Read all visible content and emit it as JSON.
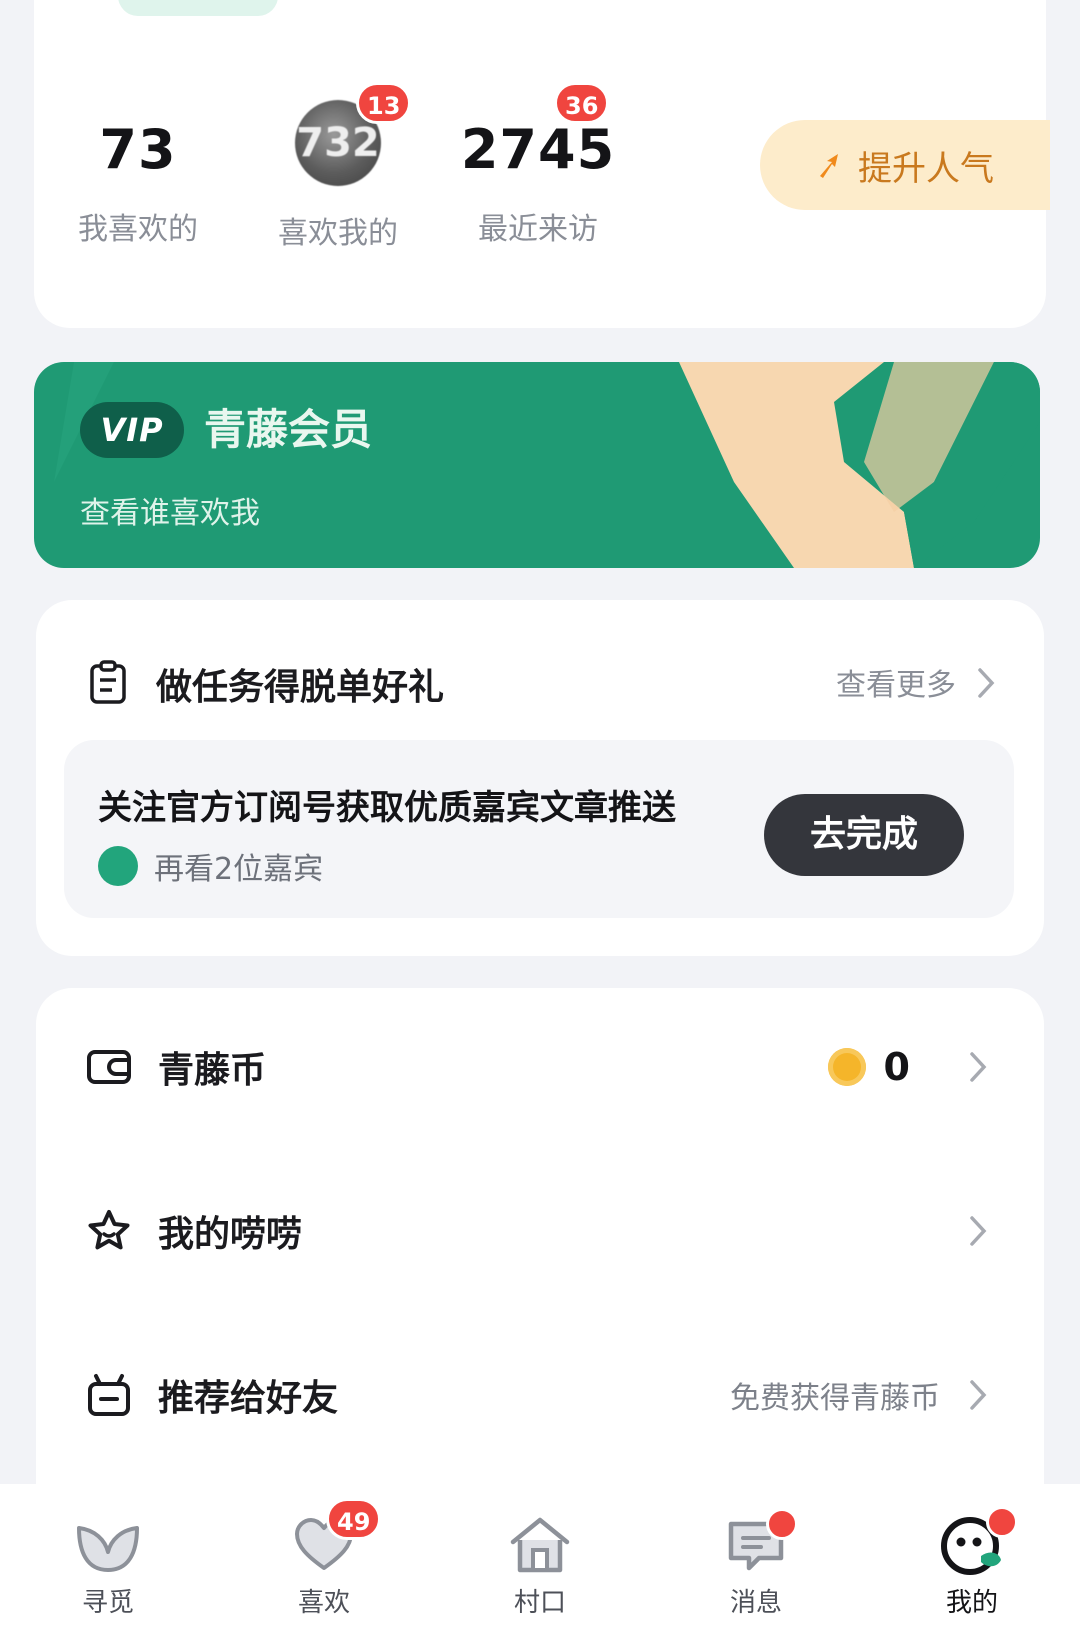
{
  "stats": {
    "liked": {
      "value": "73",
      "label": "我喜欢的"
    },
    "liked_me": {
      "value": "732",
      "label": "喜欢我的",
      "badge": "13"
    },
    "visitors": {
      "value": "2745",
      "label": "最近来访",
      "badge": "36"
    },
    "boost_label": "提升人气"
  },
  "vip": {
    "pill": "VIP",
    "title": "青藤会员",
    "subtitle": "查看谁喜欢我"
  },
  "task": {
    "header_title": "做任务得脱单好礼",
    "more_label": "查看更多",
    "desc": "关注官方订阅号获取优质嘉宾文章推送",
    "meta": "再看2位嘉宾",
    "action_label": "去完成"
  },
  "menu": {
    "coins": {
      "label": "青藤币",
      "value": "0"
    },
    "posts": {
      "label": "我的唠唠"
    },
    "invite": {
      "label": "推荐给好友",
      "hint": "免费获得青藤币"
    }
  },
  "tabs": [
    {
      "label": "寻觅"
    },
    {
      "label": "喜欢",
      "badge": "49"
    },
    {
      "label": "村口"
    },
    {
      "label": "消息"
    },
    {
      "label": "我的"
    }
  ],
  "colors": {
    "brand_green": "#1f9a74",
    "badge_red": "#f0453f",
    "boost_bg": "#fdeccb",
    "boost_text": "#c9791e",
    "dark_button": "#34363c"
  }
}
